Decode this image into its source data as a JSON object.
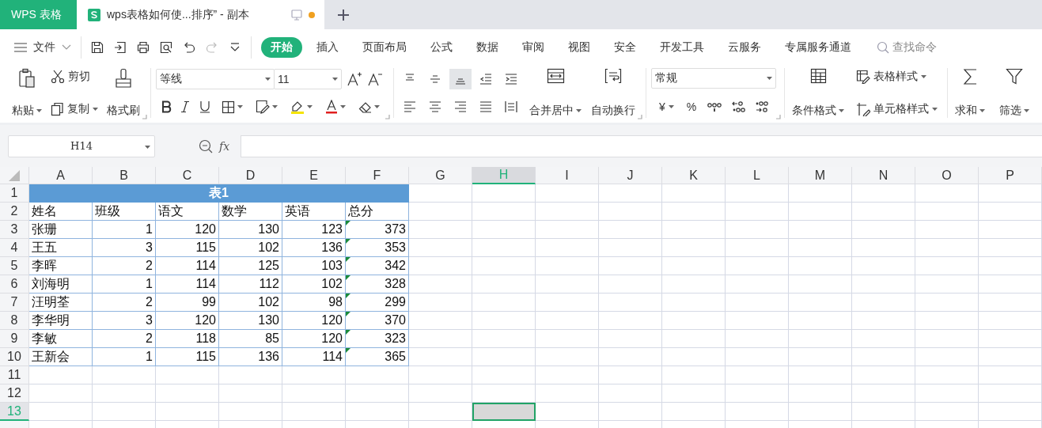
{
  "tabs": [
    {
      "label": "WPS 表格",
      "kind": "app",
      "selected": false
    },
    {
      "label": "wps表格如何使...排序”  - 副本",
      "kind": "doc",
      "selected": true,
      "modified": true
    }
  ],
  "menu": {
    "file": "文件",
    "tabs": [
      {
        "label": "开始",
        "selected": true
      },
      {
        "label": "插入",
        "selected": false
      },
      {
        "label": "页面布局",
        "selected": false
      },
      {
        "label": "公式",
        "selected": false
      },
      {
        "label": "数据",
        "selected": false
      },
      {
        "label": "审阅",
        "selected": false
      },
      {
        "label": "视图",
        "selected": false
      },
      {
        "label": "安全",
        "selected": false
      },
      {
        "label": "开发工具",
        "selected": false
      },
      {
        "label": "云服务",
        "selected": false
      },
      {
        "label": "专属服务通道",
        "selected": false
      }
    ],
    "search_placeholder": "查找命令"
  },
  "ribbon": {
    "paste": "粘贴",
    "cut": "剪切",
    "copy": "复制",
    "format_painter": "格式刷",
    "font": "等线",
    "font_size": "11",
    "vertical_align": [
      {
        "selected": false
      },
      {
        "selected": false
      },
      {
        "selected": true
      }
    ],
    "merge": "合并居中",
    "wrap": "自动换行",
    "number_format": "常规",
    "currency": "¥",
    "percent": "%",
    "conditional_format": "条件格式",
    "table_style": "表格样式",
    "cell_style": "单元格样式",
    "sum": "求和",
    "filter": "筛选"
  },
  "formula_bar": {
    "name_box": "H14",
    "function_label": "fx"
  },
  "sheet": {
    "columns": [
      {
        "label": "A",
        "selected": false
      },
      {
        "label": "B",
        "selected": false
      },
      {
        "label": "C",
        "selected": false
      },
      {
        "label": "D",
        "selected": false
      },
      {
        "label": "E",
        "selected": false
      },
      {
        "label": "F",
        "selected": false
      },
      {
        "label": "G",
        "selected": false
      },
      {
        "label": "H",
        "selected": true
      },
      {
        "label": "I",
        "selected": false
      },
      {
        "label": "J",
        "selected": false
      },
      {
        "label": "K",
        "selected": false
      },
      {
        "label": "L",
        "selected": false
      },
      {
        "label": "M",
        "selected": false
      },
      {
        "label": "N",
        "selected": false
      },
      {
        "label": "O",
        "selected": false
      },
      {
        "label": "P",
        "selected": false
      }
    ],
    "row_numbers": [
      {
        "label": "1",
        "selected": false
      },
      {
        "label": "2",
        "selected": false
      },
      {
        "label": "3",
        "selected": false
      },
      {
        "label": "4",
        "selected": false
      },
      {
        "label": "5",
        "selected": false
      },
      {
        "label": "6",
        "selected": false
      },
      {
        "label": "7",
        "selected": false
      },
      {
        "label": "8",
        "selected": false
      },
      {
        "label": "9",
        "selected": false
      },
      {
        "label": "10",
        "selected": false
      },
      {
        "label": "11",
        "selected": false
      },
      {
        "label": "12",
        "selected": false
      },
      {
        "label": "13",
        "selected": true
      }
    ],
    "title": "表1",
    "header": [
      "姓名",
      "班级",
      "语文",
      "数学",
      "英语",
      "总分"
    ],
    "records": [
      {
        "cells": [
          "张珊",
          "1",
          "120",
          "130",
          "123",
          "373"
        ],
        "flagged": true
      },
      {
        "cells": [
          "王五",
          "3",
          "115",
          "102",
          "136",
          "353"
        ],
        "flagged": true
      },
      {
        "cells": [
          "李晖",
          "2",
          "114",
          "125",
          "103",
          "342"
        ],
        "flagged": true
      },
      {
        "cells": [
          "刘海明",
          "1",
          "114",
          "112",
          "102",
          "328"
        ],
        "flagged": true
      },
      {
        "cells": [
          "汪明荃",
          "2",
          "99",
          "102",
          "98",
          "299"
        ],
        "flagged": true
      },
      {
        "cells": [
          "李华明",
          "3",
          "120",
          "130",
          "120",
          "370"
        ],
        "flagged": true
      },
      {
        "cells": [
          "李敏",
          "2",
          "118",
          "85",
          "120",
          "323"
        ],
        "flagged": true
      },
      {
        "cells": [
          "王新会",
          "1",
          "115",
          "136",
          "114",
          "365"
        ],
        "flagged": true
      }
    ]
  }
}
